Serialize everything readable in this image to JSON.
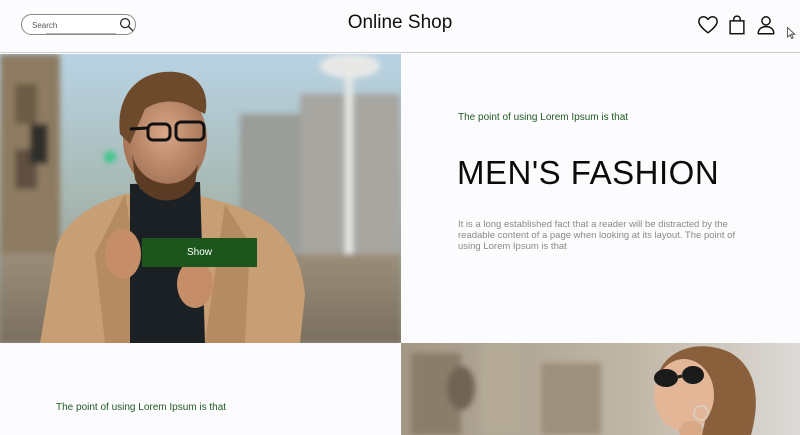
{
  "header": {
    "search_placeholder": "Search",
    "brand": "Online Shop",
    "icons": [
      "search-icon",
      "heart-icon",
      "shopping-bag-icon",
      "user-icon"
    ]
  },
  "hero": {
    "button_label": "Show",
    "kicker": "The point of using Lorem Ipsum is that",
    "title": "MEN'S FASHION",
    "description": "It is a long established fact that a reader will be distracted by the readable content of a page when looking at its layout. The point of using Lorem Ipsum is that"
  },
  "second_section": {
    "kicker": "The point of using Lorem Ipsum is that"
  },
  "colors": {
    "accent_green": "#1d561d",
    "kicker_green": "#235a23",
    "background": "#fcfbfd",
    "muted_text": "#8a8a8a"
  }
}
